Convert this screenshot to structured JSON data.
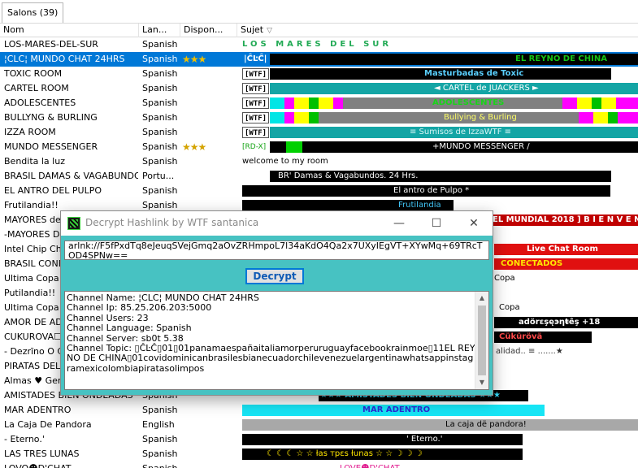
{
  "tab": {
    "label": "Salons (39)"
  },
  "columns": {
    "nom": "Nom",
    "langue": "Lan...",
    "dispo": "Dispon...",
    "sujet": "Sujet",
    "sort_glyph": "▽"
  },
  "rows": [
    {
      "name": "LOS-MARES-DEL-SUR",
      "lang": "Spanish",
      "dispo": "",
      "topic": "LOS MARES DEL SUR"
    },
    {
      "name": "¦CLC¦ MUNDO CHAT 24HRS",
      "lang": "Spanish",
      "dispo": "★★★",
      "topic": "EL REYNO DE CHINA",
      "tag": "|ĈĿĈ|",
      "selected": true
    },
    {
      "name": "TOXIC ROOM",
      "lang": "Spanish",
      "dispo": "",
      "topic": "Masturbadas de Toxic",
      "tag": "[WTF]"
    },
    {
      "name": "CARTEL ROOM",
      "lang": "Spanish",
      "dispo": "",
      "topic": "◄ CARTEL de JUACKERS ►",
      "tag": "[WTF]"
    },
    {
      "name": "ADOLESCENTES",
      "lang": "Spanish",
      "dispo": "",
      "topic": "ADOLESCENTES",
      "tag": "[WTF]"
    },
    {
      "name": "BULLYNG & BURLING",
      "lang": "Spanish",
      "dispo": "",
      "topic": "Bullying & Burling",
      "tag": "[WTF]"
    },
    {
      "name": "IZZA ROOM",
      "lang": "Spanish",
      "dispo": "",
      "topic": "≡ Sumisos de IzzaWTF ≡",
      "tag": "[WTF]"
    },
    {
      "name": "MUNDO MESSENGER",
      "lang": "Spanish",
      "dispo": "★★★",
      "topic": "+MUNDO MESSENGER /",
      "tag": "[RD-X]"
    },
    {
      "name": "Bendita la luz",
      "lang": "Spanish",
      "dispo": "",
      "topic": "welcome to my room"
    },
    {
      "name": "BRASIL DAMAS & VAGABUNDOS.",
      "lang": "Portu...",
      "dispo": "",
      "topic": "BR' Damas & Vagabundos. 24 Hrs."
    },
    {
      "name": "EL ANTRO DEL PULPO",
      "lang": "Spanish",
      "dispo": "",
      "topic": "El antro de Pulpo *"
    },
    {
      "name": "Frutilandia!!",
      "lang": "Spanish",
      "dispo": "",
      "topic": "Frutilandia"
    },
    {
      "name": "MAYORES de",
      "lang": "",
      "dispo": "",
      "topic": "EL MUNDIAL 2018 ]  B I E N V E N"
    },
    {
      "name": "-MAYORES DE",
      "lang": "",
      "dispo": "",
      "topic": ""
    },
    {
      "name": "Intel Chip Cha",
      "lang": "",
      "dispo": "",
      "topic": "Live Chat Room"
    },
    {
      "name": "BRASIL CONEC",
      "lang": "",
      "dispo": "",
      "topic": "CONECTADOS"
    },
    {
      "name": "Ultima Copa",
      "lang": "",
      "dispo": "",
      "topic": "Copa"
    },
    {
      "name": "Putilandia!!",
      "lang": "",
      "dispo": "",
      "topic": ""
    },
    {
      "name": "Ultima Copa",
      "lang": "",
      "dispo": "",
      "topic": "Copa"
    },
    {
      "name": "AMOR DE ADO",
      "lang": "",
      "dispo": "",
      "topic": "adörεşęэηŧêş  +18"
    },
    {
      "name": "CUKUROVA☐",
      "lang": "",
      "dispo": "",
      "topic": "Cükürövä"
    },
    {
      "name": "- Dezrīno O Ca",
      "lang": "",
      "dispo": "",
      "topic": "alidad.. ≡  .......★"
    },
    {
      "name": "PIRATAS DEL",
      "lang": "",
      "dispo": "",
      "topic": ""
    },
    {
      "name": "Almas ♥ Geme",
      "lang": "",
      "dispo": "",
      "topic": ""
    },
    {
      "name": "AMISTADES BIEN ONDEADAS",
      "lang": "Spanish",
      "dispo": "",
      "topic": "★★★  AMISTADES BIEN ONDEADAS  ★★★"
    },
    {
      "name": "MAR ADENTRO",
      "lang": "Spanish",
      "dispo": "",
      "topic": "MAR ADENTRO"
    },
    {
      "name": "La Caja De Pandora",
      "lang": "English",
      "dispo": "",
      "topic": "La caja dë pandora!"
    },
    {
      "name": "- Eterno.'",
      "lang": "Spanish",
      "dispo": "",
      "topic": "' Eterno.'"
    },
    {
      "name": "LAS TRES LUNAS",
      "lang": "Spanish",
      "dispo": "",
      "topic": "☾ ☾ ☾ ☆ ☆  łas  трεs  łunas  ☆ ☆ ☽ ☽ ☽"
    },
    {
      "name": "LOVO☻D'CHAT",
      "lang": "Spanish",
      "dispo": "",
      "topic": "LOVE☻D'CHAT"
    }
  ],
  "dialog": {
    "title": "Decrypt Hashlink by WTF santanica",
    "minimize_glyph": "—",
    "maximize_glyph": "☐",
    "close_glyph": "✕",
    "hashlink": "arlnk://F5fPxdTq8eJeuqSVejGmq2aOvZRHmpoL7l34aKdO4Qa2x7UXyIEgVT+XYwMq+69TRcTOD4SPNw==",
    "decrypt_label": "Decrypt",
    "info": [
      "Channel Name: ¦CLC¦ MUNDO CHAT 24HRS",
      "Channel Ip:   85.25.206.203:5000",
      "Channel Users: 23",
      "Channel Language: Spanish",
      "Channel Server: sb0t 5.38",
      "Channel Topic: ▯ĈĿĈ▯01▯01panamaespañaitaliamorperuruguayfacebookrainmoe▯11EL REYNO DE CHINA▯01covidominicanbrasilesbianecuadorchilevenezuelargentinawhatsappinstagramexicolombiapiratasolimpos"
    ]
  }
}
